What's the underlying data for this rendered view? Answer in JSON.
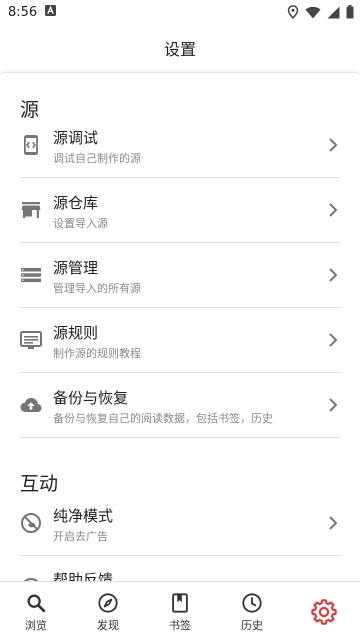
{
  "status_bar": {
    "time": "8:56",
    "notification_icon": "a-box-icon"
  },
  "app_bar": {
    "title": "设置"
  },
  "sections": [
    {
      "header": "源",
      "items": [
        {
          "icon": "code-brackets-icon",
          "title": "源调试",
          "subtitle": "调试自己制作的源"
        },
        {
          "icon": "store-icon",
          "title": "源仓库",
          "subtitle": "设置导入源"
        },
        {
          "icon": "list-rows-icon",
          "title": "源管理",
          "subtitle": "管理导入的所有源"
        },
        {
          "icon": "screen-icon",
          "title": "源规则",
          "subtitle": "制作源的规则教程"
        },
        {
          "icon": "cloud-upload-icon",
          "title": "备份与恢复",
          "subtitle": "备份与恢复自己的阅读数据，包括书签，历史"
        }
      ]
    },
    {
      "header": "互动",
      "items": [
        {
          "icon": "eye-slash-icon",
          "title": "纯净模式",
          "subtitle": "开启去广告"
        },
        {
          "icon": "help-icon",
          "title": "帮助反馈",
          "subtitle": ""
        }
      ]
    }
  ],
  "bottom_nav": [
    {
      "icon": "search-icon",
      "label": "浏览"
    },
    {
      "icon": "compass-icon",
      "label": "发现"
    },
    {
      "icon": "bookmark-book-icon",
      "label": "书签"
    },
    {
      "icon": "clock-icon",
      "label": "历史"
    },
    {
      "icon": "gear-icon",
      "label": "",
      "active": true
    }
  ],
  "colors": {
    "accent": "#e53935",
    "icon_gray": "#757575",
    "subtitle_gray": "#8a8a8a",
    "divider": "#e0e0e0"
  }
}
